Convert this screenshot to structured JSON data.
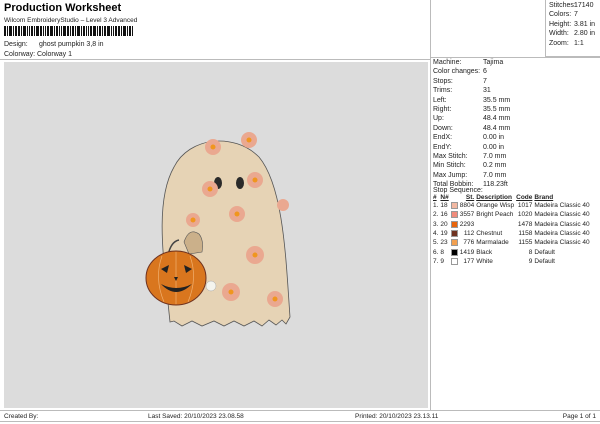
{
  "header": {
    "title": "Production Worksheet",
    "subtitle": "Wilcom EmbroideryStudio – Level 3 Advanced",
    "design_label": "Design:",
    "design_value": "ghost pumpkin 3,8 in",
    "colorway_label": "Colorway:",
    "colorway_value": "Colorway 1"
  },
  "stats": [
    {
      "k": "Stitches:",
      "v": "17140"
    },
    {
      "k": "Colors:",
      "v": "7"
    },
    {
      "k": "Height:",
      "v": "3.81 in"
    },
    {
      "k": "Width:",
      "v": "2.80 in"
    },
    {
      "k": "Zoom:",
      "v": "1:1"
    }
  ],
  "machine": [
    {
      "k": "Machine:",
      "v": "Tajima"
    },
    {
      "k": "Color changes:",
      "v": "6"
    },
    {
      "k": "Stops:",
      "v": "7"
    },
    {
      "k": "Trims:",
      "v": "31"
    },
    {
      "k": "Left:",
      "v": "35.5 mm"
    },
    {
      "k": "Right:",
      "v": "35.5 mm"
    },
    {
      "k": "Up:",
      "v": "48.4 mm"
    },
    {
      "k": "Down:",
      "v": "48.4 mm"
    },
    {
      "k": "EndX:",
      "v": "0.00 in"
    },
    {
      "k": "EndY:",
      "v": "0.00 in"
    },
    {
      "k": "Max Stitch:",
      "v": "7.0 mm"
    },
    {
      "k": "Min Stitch:",
      "v": "0.2 mm"
    },
    {
      "k": "Max Jump:",
      "v": "7.0 mm"
    },
    {
      "k": "Total Bobbin:",
      "v": "118.23ft"
    }
  ],
  "stop_sequence": {
    "title": "Stop Sequence:",
    "headers": [
      "#",
      "N#",
      "St.",
      "Description",
      "Code",
      "Brand"
    ],
    "rows": [
      {
        "n": "1.",
        "nn": "18",
        "color": "#f2b8a2",
        "st": "8804",
        "desc": "Orange Wisp",
        "code": "1017",
        "brand": "Madeira Classic 40"
      },
      {
        "n": "2.",
        "nn": "16",
        "color": "#f08c7c",
        "st": "3557",
        "desc": "Bright Peach",
        "code": "1020",
        "brand": "Madeira Classic 40"
      },
      {
        "n": "3.",
        "nn": "20",
        "color": "#e8650c",
        "st": "2293",
        "desc": "",
        "code": "1478",
        "brand": "Madeira Classic 40"
      },
      {
        "n": "4.",
        "nn": "19",
        "color": "#6e3220",
        "st": "112",
        "desc": "Chestnut",
        "code": "1158",
        "brand": "Madeira Classic 40"
      },
      {
        "n": "5.",
        "nn": "23",
        "color": "#f2a050",
        "st": "776",
        "desc": "Marmalade",
        "code": "1155",
        "brand": "Madeira Classic 40"
      },
      {
        "n": "6.",
        "nn": "8",
        "color": "#000000",
        "st": "1419",
        "desc": "Black",
        "code": "8",
        "brand": "Default"
      },
      {
        "n": "7.",
        "nn": "9",
        "color": "#ffffff",
        "st": "177",
        "desc": "White",
        "code": "9",
        "brand": "Default"
      }
    ]
  },
  "footer": {
    "created": "Created By:",
    "saved": "Last Saved: 20/10/2023 23.08.58",
    "printed": "Printed: 20/10/2023 23.13.11",
    "page": "Page 1 of 1"
  }
}
